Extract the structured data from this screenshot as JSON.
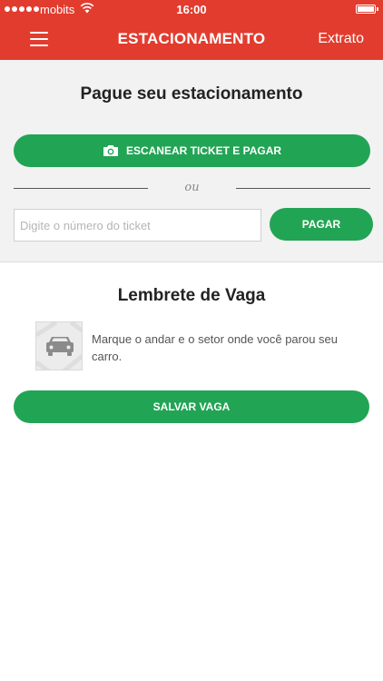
{
  "status_bar": {
    "carrier": "mobits",
    "time": "16:00"
  },
  "nav": {
    "title": "ESTACIONAMENTO",
    "action": "Extrato",
    "menu_icon": "hamburger-menu-icon"
  },
  "pay": {
    "title": "Pague seu estacionamento",
    "scan_label": "ESCANEAR TICKET E PAGAR",
    "scan_icon": "camera-icon",
    "divider": "ou",
    "ticket_placeholder": "Digite o número do ticket",
    "ticket_value": "",
    "pay_label": "PAGAR"
  },
  "reminder": {
    "title": "Lembrete de Vaga",
    "icon": "map-car-icon",
    "text": "Marque o andar e o setor onde você parou seu carro.",
    "save_label": "SALVAR VAGA"
  },
  "colors": {
    "brand_red": "#e23c2e",
    "button_green": "#22a455",
    "section_bg": "#f2f2f2"
  }
}
